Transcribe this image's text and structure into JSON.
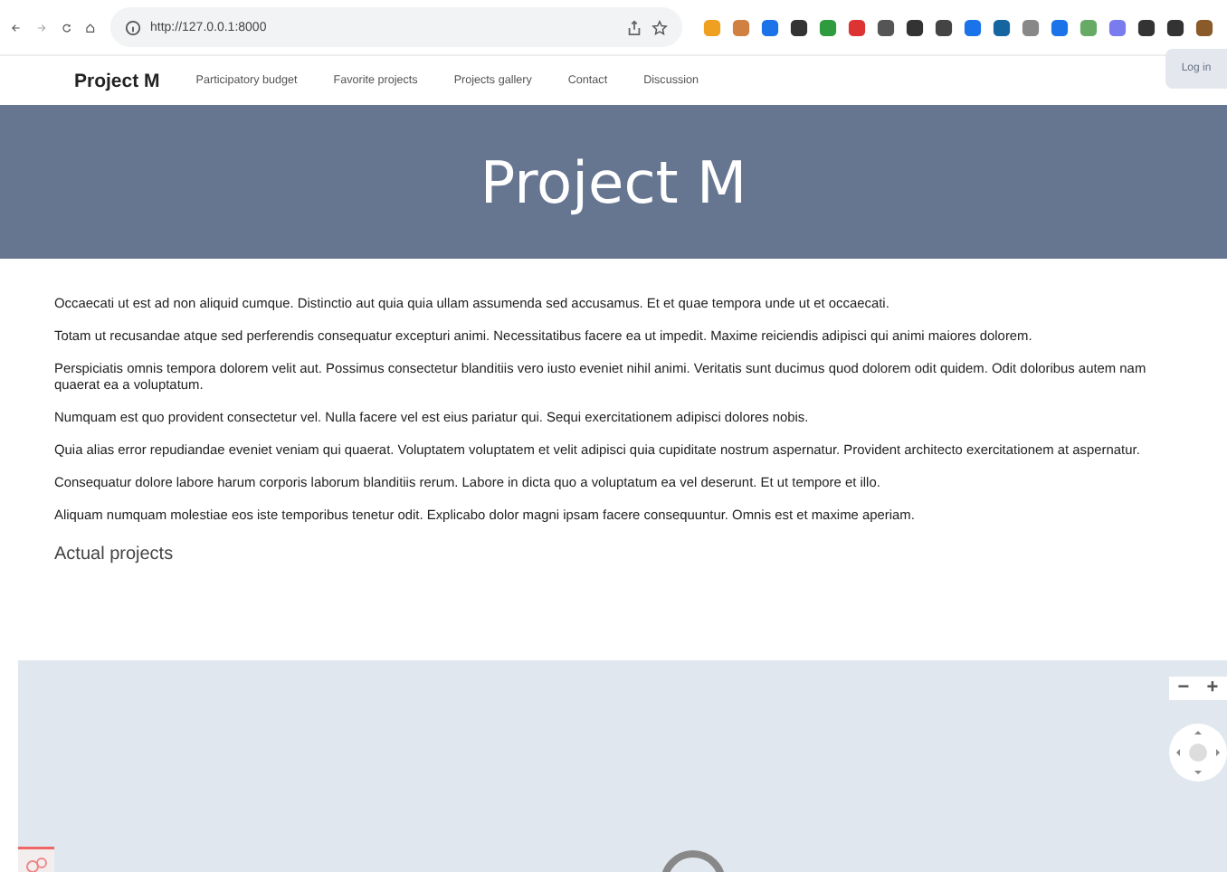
{
  "browser": {
    "url": "http://127.0.0.1:8000"
  },
  "nav": {
    "brand": "Project M",
    "links": [
      {
        "label": "Participatory budget"
      },
      {
        "label": "Favorite projects"
      },
      {
        "label": "Projects gallery"
      },
      {
        "label": "Contact"
      },
      {
        "label": "Discussion"
      }
    ],
    "login": "Log in"
  },
  "hero": {
    "title": "Project M"
  },
  "paragraphs": [
    "Occaecati ut est ad non aliquid cumque. Distinctio aut quia quia ullam assumenda sed accusamus. Et et quae tempora unde ut et occaecati.",
    "Totam ut recusandae atque sed perferendis consequatur excepturi animi. Necessitatibus facere ea ut impedit. Maxime reiciendis adipisci qui animi maiores dolorem.",
    "Perspiciatis omnis tempora dolorem velit aut. Possimus consectetur blanditiis vero iusto eveniet nihil animi. Veritatis sunt ducimus quod dolorem odit quidem. Odit doloribus autem nam quaerat ea a voluptatum.",
    "Numquam est quo provident consectetur vel. Nulla facere vel est eius pariatur qui. Sequi exercitationem adipisci dolores nobis.",
    "Quia alias error repudiandae eveniet veniam qui quaerat. Voluptatem voluptatem et velit adipisci quia cupiditate nostrum aspernatur. Provident architecto exercitationem at aspernatur.",
    "Consequatur dolore labore harum corporis laborum blanditiis rerum. Labore in dicta quo a voluptatum ea vel deserunt. Et ut tempore et illo.",
    "Aliquam numquam molestiae eos iste temporibus tenetur odit. Explicabo dolor magni ipsam facere consequuntur. Omnis est et maxime aperiam."
  ],
  "section_title": "Actual projects",
  "map": {
    "zoom_out": "−",
    "zoom_in": "+"
  }
}
